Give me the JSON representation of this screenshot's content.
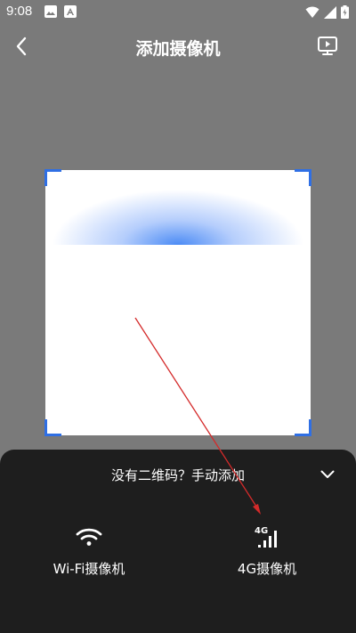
{
  "status_bar": {
    "time": "9:08"
  },
  "header": {
    "title": "添加摄像机"
  },
  "scanner": {
    "accent_color": "#2f6fe4"
  },
  "bottom_sheet": {
    "header": "没有二维码？手动添加",
    "options": [
      {
        "label": "Wi-Fi摄像机",
        "icon": "wifi-icon"
      },
      {
        "label": "4G摄像机",
        "icon": "4g-signal-icon"
      }
    ]
  }
}
